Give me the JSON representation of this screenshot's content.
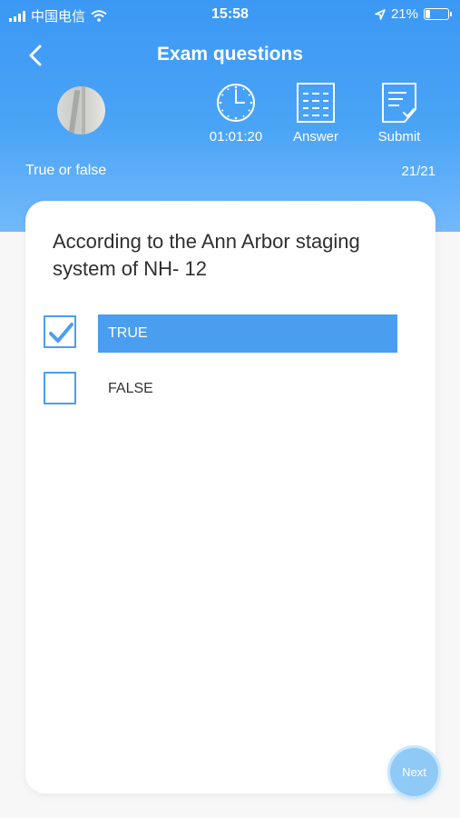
{
  "status_bar": {
    "carrier": "中国电信",
    "time": "15:58",
    "battery": "21%",
    "battery_level": 0.21
  },
  "header": {
    "title": "Exam questions"
  },
  "toolbar": {
    "timer": "01:01:20",
    "answer_label": "Answer",
    "submit_label": "Submit"
  },
  "question_meta": {
    "type": "True or false",
    "progress": "21/21"
  },
  "question": {
    "text": "According to the Ann Arbor staging system of NH- 12",
    "options": [
      {
        "label": "TRUE",
        "checked": true
      },
      {
        "label": "FALSE",
        "checked": false
      }
    ]
  },
  "next_label": "Next",
  "colors": {
    "accent": "#4a9ef0",
    "header_top": "#3b98f4",
    "header_bottom": "#73b9fb"
  }
}
